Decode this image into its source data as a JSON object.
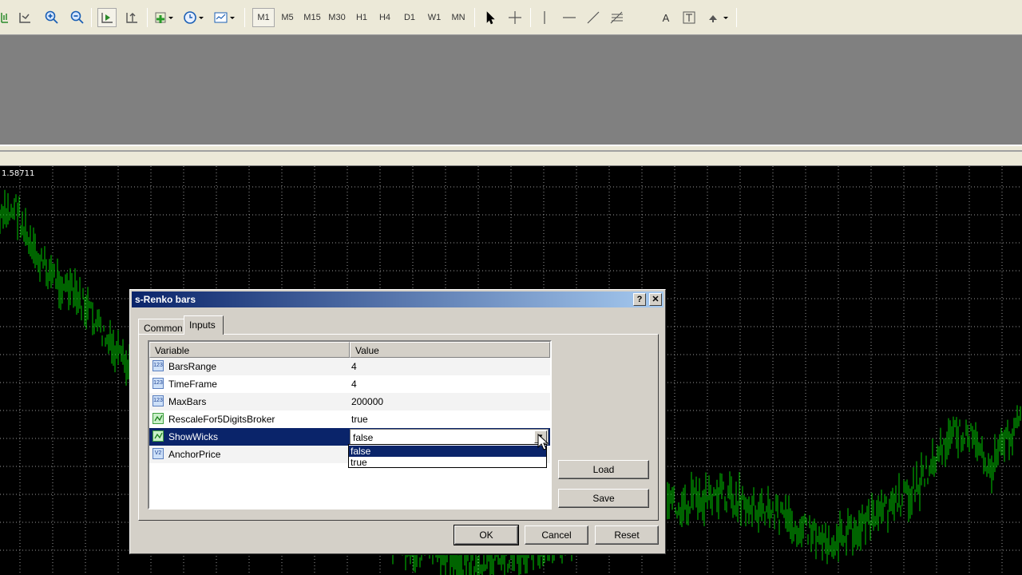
{
  "toolbar": {
    "timeframes": [
      "M1",
      "M5",
      "M15",
      "M30",
      "H1",
      "H4",
      "D1",
      "W1",
      "MN"
    ],
    "active_timeframe": "M1",
    "text_tool": "A"
  },
  "chart": {
    "price_label": "1.58711",
    "candle_color": "#00c800",
    "grid_color": "#9a9a9a"
  },
  "dialog": {
    "title": "s-Renko bars",
    "help_label": "?",
    "close_label": "✕",
    "tabs": [
      {
        "label": "Common",
        "active": false
      },
      {
        "label": "Inputs",
        "active": true
      }
    ],
    "grid": {
      "headers": [
        "Variable",
        "Value"
      ],
      "rows": [
        {
          "icon": "123",
          "variable": "BarsRange",
          "value": "4"
        },
        {
          "icon": "123",
          "variable": "TimeFrame",
          "value": "4"
        },
        {
          "icon": "123",
          "variable": "MaxBars",
          "value": "200000"
        },
        {
          "icon": "bool",
          "variable": "RescaleFor5DigitsBroker",
          "value": "true"
        },
        {
          "icon": "bool",
          "variable": "ShowWicks",
          "value": "false"
        },
        {
          "icon": "V2",
          "variable": "AnchorPrice",
          "value": ""
        }
      ]
    },
    "dropdown_options": [
      "false",
      "true"
    ],
    "buttons": {
      "load": "Load",
      "save": "Save",
      "ok": "OK",
      "cancel": "Cancel",
      "reset": "Reset"
    }
  }
}
